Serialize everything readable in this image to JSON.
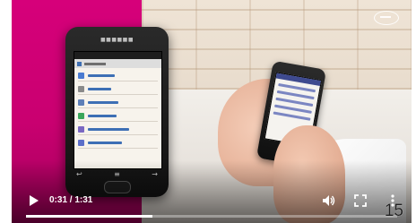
{
  "player": {
    "current_time": "0:31",
    "duration": "1:31",
    "time_display": "0:31 / 1:31",
    "progress": 0.34
  },
  "icons": {
    "play": "play-icon",
    "volume": "volume-icon",
    "fullscreen": "fullscreen-icon",
    "more": "more-vert-icon",
    "logo": "brand-logo-icon"
  },
  "overlay": {
    "page_counter": "15"
  },
  "colors": {
    "brand_magenta": "#d6007a",
    "progress_fill": "#ffffff"
  }
}
